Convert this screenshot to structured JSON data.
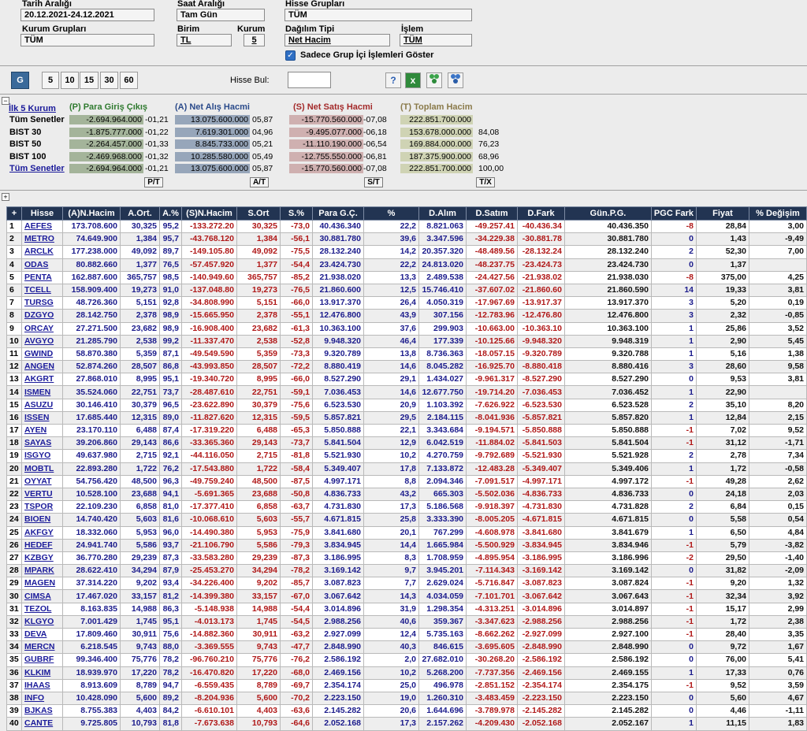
{
  "filters": {
    "date_label": "Tarih Aralığı",
    "date_value": "20.12.2021-24.12.2021",
    "time_label": "Saat Aralığı",
    "time_value": "Tam Gün",
    "stock_groups_label": "Hisse Grupları",
    "stock_groups_value": "TÜM",
    "inst_groups_label": "Kurum Grupları",
    "inst_groups_value": "TÜM",
    "unit_label": "Birim",
    "unit_value": "TL",
    "inst_label": "Kurum",
    "inst_value": "5",
    "dist_label": "Dağılım Tipi",
    "dist_value": "Net Hacim",
    "trade_label": "İşlem",
    "trade_value": "TÜM",
    "checkbox_label": "Sadece Grup İçi İşlemleri Göster"
  },
  "toolbar": {
    "g_label": "G",
    "periods": [
      "5",
      "10",
      "15",
      "30",
      "60"
    ],
    "search_label": "Hisse Bul:",
    "search_value": ""
  },
  "summary": {
    "title": "İlk 5 Kurum",
    "col_p": "(P) Para Giriş Çıkış",
    "col_a": "(A) Net Alış Hacmi",
    "col_s": "(S) Net Satış Hacmi",
    "col_t": "(T) Toplam Hacim",
    "rows": [
      {
        "name": "Tüm Senetler",
        "p": "-2.694.964.000",
        "pp": "-01,21",
        "a": "13.075.600.000",
        "ap": "05,87",
        "s": "-15.770.560.000",
        "sp": "-07,08",
        "t": "222.851.700.000",
        "tp": ""
      },
      {
        "name": "BIST 30",
        "p": "-1.875.777.000",
        "pp": "-01,22",
        "a": "7.619.301.000",
        "ap": "04,96",
        "s": "-9.495.077.000",
        "sp": "-06,18",
        "t": "153.678.000.000",
        "tp": "84,08"
      },
      {
        "name": "BIST 50",
        "p": "-2.264.457.000",
        "pp": "-01,33",
        "a": "8.845.733.000",
        "ap": "05,21",
        "s": "-11.110.190.000",
        "sp": "-06,54",
        "t": "169.884.000.000",
        "tp": "76,23"
      },
      {
        "name": "BIST 100",
        "p": "-2.469.968.000",
        "pp": "-01,32",
        "a": "10.285.580.000",
        "ap": "05,49",
        "s": "-12.755.550.000",
        "sp": "-06,81",
        "t": "187.375.900.000",
        "tp": "68,96"
      },
      {
        "name": "Tüm Senetler",
        "p": "-2.694.964.000",
        "pp": "-01,21",
        "a": "13.075.600.000",
        "ap": "05,87",
        "s": "-15.770.560.000",
        "sp": "-07,08",
        "t": "222.851.700.000",
        "tp": "100,00"
      }
    ],
    "btn_p": "P/T",
    "btn_a": "A/T",
    "btn_s": "S/T",
    "btn_t": "T/X"
  },
  "columns": [
    "+",
    "Hisse",
    "(A)N.Hacim",
    "A.Ort.",
    "A.%",
    "(S)N.Hacim",
    "S.Ort",
    "S.%",
    "Para G.Ç.",
    "%",
    "D.Alım",
    "D.Satım",
    "D.Fark",
    "Gün.P.G.",
    "PGC Fark",
    "Fiyat",
    "% Değişim"
  ],
  "rows": [
    [
      "1",
      "AEFES",
      "173.708.600",
      "30,325",
      "95,2",
      "-133.272.20",
      "30,325",
      "-73,0",
      "40.436.340",
      "22,2",
      "8.821.063",
      "-49.257.41",
      "-40.436.34",
      "40.436.350",
      "-8",
      "28,84",
      "3,00"
    ],
    [
      "2",
      "METRO",
      "74.649.900",
      "1,384",
      "95,7",
      "-43.768.120",
      "1,384",
      "-56,1",
      "30.881.780",
      "39,6",
      "3.347.596",
      "-34.229.38",
      "-30.881.78",
      "30.881.780",
      "0",
      "1,43",
      "-9,49"
    ],
    [
      "3",
      "ARCLK",
      "177.238.000",
      "49,092",
      "89,7",
      "-149.105.80",
      "49,092",
      "-75,5",
      "28.132.240",
      "14,2",
      "20.357.320",
      "-48.489.56",
      "-28.132.24",
      "28.132.240",
      "2",
      "52,30",
      "7,00"
    ],
    [
      "4",
      "ODAS",
      "80.882.660",
      "1,377",
      "76,5",
      "-57.457.920",
      "1,377",
      "-54,4",
      "23.424.730",
      "22,2",
      "24.813.020",
      "-48.237.75",
      "-23.424.73",
      "23.424.730",
      "0",
      "1,37",
      ""
    ],
    [
      "5",
      "PENTA",
      "162.887.600",
      "365,757",
      "98,5",
      "-140.949.60",
      "365,757",
      "-85,2",
      "21.938.020",
      "13,3",
      "2.489.538",
      "-24.427.56",
      "-21.938.02",
      "21.938.030",
      "-8",
      "375,00",
      "4,25"
    ],
    [
      "6",
      "TCELL",
      "158.909.400",
      "19,273",
      "91,0",
      "-137.048.80",
      "19,273",
      "-76,5",
      "21.860.600",
      "12,5",
      "15.746.410",
      "-37.607.02",
      "-21.860.60",
      "21.860.590",
      "14",
      "19,33",
      "3,81"
    ],
    [
      "7",
      "TURSG",
      "48.726.360",
      "5,151",
      "92,8",
      "-34.808.990",
      "5,151",
      "-66,0",
      "13.917.370",
      "26,4",
      "4.050.319",
      "-17.967.69",
      "-13.917.37",
      "13.917.370",
      "3",
      "5,20",
      "0,19"
    ],
    [
      "8",
      "DZGYO",
      "28.142.750",
      "2,378",
      "98,9",
      "-15.665.950",
      "2,378",
      "-55,1",
      "12.476.800",
      "43,9",
      "307.156",
      "-12.783.96",
      "-12.476.80",
      "12.476.800",
      "3",
      "2,32",
      "-0,85"
    ],
    [
      "9",
      "ORCAY",
      "27.271.500",
      "23,682",
      "98,9",
      "-16.908.400",
      "23,682",
      "-61,3",
      "10.363.100",
      "37,6",
      "299.903",
      "-10.663.00",
      "-10.363.10",
      "10.363.100",
      "1",
      "25,86",
      "3,52"
    ],
    [
      "10",
      "AVGYO",
      "21.285.790",
      "2,538",
      "99,2",
      "-11.337.470",
      "2,538",
      "-52,8",
      "9.948.320",
      "46,4",
      "177.339",
      "-10.125.66",
      "-9.948.320",
      "9.948.319",
      "1",
      "2,90",
      "5,45"
    ],
    [
      "11",
      "GWIND",
      "58.870.380",
      "5,359",
      "87,1",
      "-49.549.590",
      "5,359",
      "-73,3",
      "9.320.789",
      "13,8",
      "8.736.363",
      "-18.057.15",
      "-9.320.789",
      "9.320.788",
      "1",
      "5,16",
      "1,38"
    ],
    [
      "12",
      "ANGEN",
      "52.874.260",
      "28,507",
      "86,8",
      "-43.993.850",
      "28,507",
      "-72,2",
      "8.880.419",
      "14,6",
      "8.045.282",
      "-16.925.70",
      "-8.880.418",
      "8.880.416",
      "3",
      "28,60",
      "9,58"
    ],
    [
      "13",
      "AKGRT",
      "27.868.010",
      "8,995",
      "95,1",
      "-19.340.720",
      "8,995",
      "-66,0",
      "8.527.290",
      "29,1",
      "1.434.027",
      "-9.961.317",
      "-8.527.290",
      "8.527.290",
      "0",
      "9,53",
      "3,81"
    ],
    [
      "14",
      "ISMEN",
      "35.524.060",
      "22,751",
      "73,7",
      "-28.487.610",
      "22,751",
      "-59,1",
      "7.036.453",
      "14,6",
      "12.677.750",
      "-19.714.20",
      "-7.036.453",
      "7.036.452",
      "1",
      "22,90",
      ""
    ],
    [
      "15",
      "ASUZU",
      "30.146.410",
      "30,379",
      "96,5",
      "-23.622.890",
      "30,379",
      "-75,6",
      "6.523.530",
      "20,9",
      "1.103.392",
      "-7.626.922",
      "-6.523.530",
      "6.523.528",
      "2",
      "35,10",
      "8,20"
    ],
    [
      "16",
      "ISSEN",
      "17.685.440",
      "12,315",
      "89,0",
      "-11.827.620",
      "12,315",
      "-59,5",
      "5.857.821",
      "29,5",
      "2.184.115",
      "-8.041.936",
      "-5.857.821",
      "5.857.820",
      "1",
      "12,84",
      "2,15"
    ],
    [
      "17",
      "AYEN",
      "23.170.110",
      "6,488",
      "87,4",
      "-17.319.220",
      "6,488",
      "-65,3",
      "5.850.888",
      "22,1",
      "3.343.684",
      "-9.194.571",
      "-5.850.888",
      "5.850.888",
      "-1",
      "7,02",
      "9,52"
    ],
    [
      "18",
      "SAYAS",
      "39.206.860",
      "29,143",
      "86,6",
      "-33.365.360",
      "29,143",
      "-73,7",
      "5.841.504",
      "12,9",
      "6.042.519",
      "-11.884.02",
      "-5.841.503",
      "5.841.504",
      "-1",
      "31,12",
      "-1,71"
    ],
    [
      "19",
      "ISGYO",
      "49.637.980",
      "2,715",
      "92,1",
      "-44.116.050",
      "2,715",
      "-81,8",
      "5.521.930",
      "10,2",
      "4.270.759",
      "-9.792.689",
      "-5.521.930",
      "5.521.928",
      "2",
      "2,78",
      "7,34"
    ],
    [
      "20",
      "MOBTL",
      "22.893.280",
      "1,722",
      "76,2",
      "-17.543.880",
      "1,722",
      "-58,4",
      "5.349.407",
      "17,8",
      "7.133.872",
      "-12.483.28",
      "-5.349.407",
      "5.349.406",
      "1",
      "1,72",
      "-0,58"
    ],
    [
      "21",
      "OYYAT",
      "54.756.420",
      "48,500",
      "96,3",
      "-49.759.240",
      "48,500",
      "-87,5",
      "4.997.171",
      "8,8",
      "2.094.346",
      "-7.091.517",
      "-4.997.171",
      "4.997.172",
      "-1",
      "49,28",
      "2,62"
    ],
    [
      "22",
      "VERTU",
      "10.528.100",
      "23,688",
      "94,1",
      "-5.691.365",
      "23,688",
      "-50,8",
      "4.836.733",
      "43,2",
      "665.303",
      "-5.502.036",
      "-4.836.733",
      "4.836.733",
      "0",
      "24,18",
      "2,03"
    ],
    [
      "23",
      "TSPOR",
      "22.109.230",
      "6,858",
      "81,0",
      "-17.377.410",
      "6,858",
      "-63,7",
      "4.731.830",
      "17,3",
      "5.186.568",
      "-9.918.397",
      "-4.731.830",
      "4.731.828",
      "2",
      "6,84",
      "0,15"
    ],
    [
      "24",
      "BIOEN",
      "14.740.420",
      "5,603",
      "81,6",
      "-10.068.610",
      "5,603",
      "-55,7",
      "4.671.815",
      "25,8",
      "3.333.390",
      "-8.005.205",
      "-4.671.815",
      "4.671.815",
      "0",
      "5,58",
      "0,54"
    ],
    [
      "25",
      "AKFGY",
      "18.332.060",
      "5,953",
      "96,0",
      "-14.490.380",
      "5,953",
      "-75,9",
      "3.841.680",
      "20,1",
      "767.299",
      "-4.608.978",
      "-3.841.680",
      "3.841.679",
      "1",
      "6,50",
      "4,84"
    ],
    [
      "26",
      "HEDEF",
      "24.941.740",
      "5,586",
      "93,7",
      "-21.106.790",
      "5,586",
      "-79,3",
      "3.834.945",
      "14,4",
      "1.665.984",
      "-5.500.929",
      "-3.834.945",
      "3.834.946",
      "-1",
      "5,79",
      "-3,82"
    ],
    [
      "27",
      "KZBGY",
      "36.770.280",
      "29,239",
      "87,3",
      "-33.583.280",
      "29,239",
      "-87,3",
      "3.186.995",
      "8,3",
      "1.708.959",
      "-4.895.954",
      "-3.186.995",
      "3.186.996",
      "-2",
      "29,50",
      "-1,40"
    ],
    [
      "28",
      "MPARK",
      "28.622.410",
      "34,294",
      "87,9",
      "-25.453.270",
      "34,294",
      "-78,2",
      "3.169.142",
      "9,7",
      "3.945.201",
      "-7.114.343",
      "-3.169.142",
      "3.169.142",
      "0",
      "31,82",
      "-2,09"
    ],
    [
      "29",
      "MAGEN",
      "37.314.220",
      "9,202",
      "93,4",
      "-34.226.400",
      "9,202",
      "-85,7",
      "3.087.823",
      "7,7",
      "2.629.024",
      "-5.716.847",
      "-3.087.823",
      "3.087.824",
      "-1",
      "9,20",
      "1,32"
    ],
    [
      "30",
      "CIMSA",
      "17.467.020",
      "33,157",
      "81,2",
      "-14.399.380",
      "33,157",
      "-67,0",
      "3.067.642",
      "14,3",
      "4.034.059",
      "-7.101.701",
      "-3.067.642",
      "3.067.643",
      "-1",
      "32,34",
      "3,92"
    ],
    [
      "31",
      "TEZOL",
      "8.163.835",
      "14,988",
      "86,3",
      "-5.148.938",
      "14,988",
      "-54,4",
      "3.014.896",
      "31,9",
      "1.298.354",
      "-4.313.251",
      "-3.014.896",
      "3.014.897",
      "-1",
      "15,17",
      "2,99"
    ],
    [
      "32",
      "KLGYO",
      "7.001.429",
      "1,745",
      "95,1",
      "-4.013.173",
      "1,745",
      "-54,5",
      "2.988.256",
      "40,6",
      "359.367",
      "-3.347.623",
      "-2.988.256",
      "2.988.256",
      "-1",
      "1,72",
      "2,38"
    ],
    [
      "33",
      "DEVA",
      "17.809.460",
      "30,911",
      "75,6",
      "-14.882.360",
      "30,911",
      "-63,2",
      "2.927.099",
      "12,4",
      "5.735.163",
      "-8.662.262",
      "-2.927.099",
      "2.927.100",
      "-1",
      "28,40",
      "3,35"
    ],
    [
      "34",
      "MERCN",
      "6.218.545",
      "9,743",
      "88,0",
      "-3.369.555",
      "9,743",
      "-47,7",
      "2.848.990",
      "40,3",
      "846.615",
      "-3.695.605",
      "-2.848.990",
      "2.848.990",
      "0",
      "9,72",
      "1,67"
    ],
    [
      "35",
      "GUBRF",
      "99.346.400",
      "75,776",
      "78,2",
      "-96.760.210",
      "75,776",
      "-76,2",
      "2.586.192",
      "2,0",
      "27.682.010",
      "-30.268.20",
      "-2.586.192",
      "2.586.192",
      "0",
      "76,00",
      "5,41"
    ],
    [
      "36",
      "KLKIM",
      "18.939.970",
      "17,220",
      "78,2",
      "-16.470.820",
      "17,220",
      "-68,0",
      "2.469.156",
      "10,2",
      "5.268.200",
      "-7.737.356",
      "-2.469.156",
      "2.469.155",
      "1",
      "17,33",
      "0,76"
    ],
    [
      "37",
      "IHAAS",
      "8.913.609",
      "8,789",
      "94,7",
      "-6.559.435",
      "8,789",
      "-69,7",
      "2.354.174",
      "25,0",
      "496.978",
      "-2.851.152",
      "-2.354.174",
      "2.354.175",
      "-1",
      "9,52",
      "3,59"
    ],
    [
      "38",
      "INFO",
      "10.428.090",
      "5,600",
      "89,2",
      "-8.204.936",
      "5,600",
      "-70,2",
      "2.223.150",
      "19,0",
      "1.260.310",
      "-3.483.459",
      "-2.223.150",
      "2.223.150",
      "0",
      "5,60",
      "4,67"
    ],
    [
      "39",
      "BJKAS",
      "8.755.383",
      "4,403",
      "84,2",
      "-6.610.101",
      "4,403",
      "-63,6",
      "2.145.282",
      "20,6",
      "1.644.696",
      "-3.789.978",
      "-2.145.282",
      "2.145.282",
      "0",
      "4,46",
      "-1,11"
    ],
    [
      "40",
      "CANTE",
      "9.725.805",
      "10,793",
      "81,8",
      "-7.673.638",
      "10,793",
      "-64,6",
      "2.052.168",
      "17,3",
      "2.157.262",
      "-4.209.430",
      "-2.052.168",
      "2.052.167",
      "1",
      "11,15",
      "1,83"
    ]
  ],
  "colors": {
    "header_bg": "#223452",
    "p_bar": "#a4b49a",
    "a_bar": "#97a6ba",
    "s_bar": "#cfb0b0",
    "t_bar": "#cfd3b4",
    "blue_text": "#1b1b8c",
    "red_text": "#b01818"
  }
}
